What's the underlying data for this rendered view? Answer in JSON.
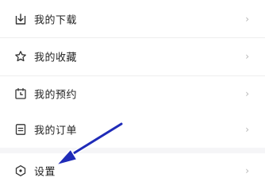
{
  "menu": {
    "items": [
      {
        "label": "我的下载",
        "icon": "download-box-icon"
      },
      {
        "label": "我的收藏",
        "icon": "star-icon"
      },
      {
        "label": "我的预约",
        "icon": "calendar-clock-icon"
      },
      {
        "label": "我的订单",
        "icon": "order-list-icon"
      }
    ],
    "settings": {
      "label": "设置",
      "icon": "settings-icon"
    },
    "chevron": "›"
  },
  "annotation": {
    "arrow_color": "#1f2bb8",
    "arrow_target": "settings"
  }
}
